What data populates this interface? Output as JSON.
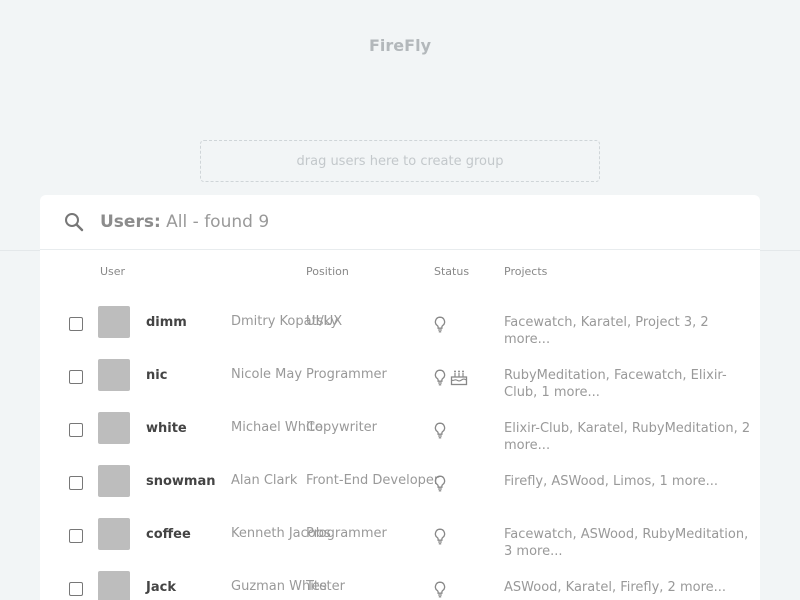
{
  "app": {
    "title": "FireFly"
  },
  "drop_zone": {
    "text": "drag users here to create group"
  },
  "panel": {
    "heading_label": "Users:",
    "heading_value": "All - found 9",
    "columns": {
      "user": "User",
      "position": "Position",
      "status": "Status",
      "projects": "Projects"
    },
    "rows": [
      {
        "username": "dimm",
        "fullname": "Dmitry Kopatsky",
        "position": "UI/UX",
        "status_icons": [
          "lightbulb-icon"
        ],
        "projects": "Facewatch, Karatel, Project 3, 2 more..."
      },
      {
        "username": "nic",
        "fullname": "Nicole May",
        "position": "Programmer",
        "status_icons": [
          "lightbulb-icon",
          "birthday-cake-icon"
        ],
        "projects": "RubyMeditation, Facewatch, Elixir-Club, 1 more..."
      },
      {
        "username": "white",
        "fullname": "Michael White",
        "position": "Copywriter",
        "status_icons": [
          "lightbulb-icon"
        ],
        "projects": "Elixir-Club, Karatel, RubyMeditation, 2 more..."
      },
      {
        "username": "snowman",
        "fullname": "Alan Clark",
        "position": "Front-End Developer",
        "status_icons": [
          "lightbulb-icon"
        ],
        "projects": "Firefly, ASWood, Limos, 1 more..."
      },
      {
        "username": "coffee",
        "fullname": "Kenneth Jacobs",
        "position": "Programmer",
        "status_icons": [
          "lightbulb-icon"
        ],
        "projects": "Facewatch, ASWood, RubyMeditation, 3 more..."
      },
      {
        "username": "Jack",
        "fullname": "Guzman White",
        "position": "Tester",
        "status_icons": [
          "lightbulb-icon"
        ],
        "projects": "ASWood, Karatel, Firefly, 2 more..."
      }
    ]
  },
  "colors": {
    "background": "#f2f5f6",
    "panel": "#ffffff",
    "avatar_placeholder": "#bdbdbd"
  }
}
